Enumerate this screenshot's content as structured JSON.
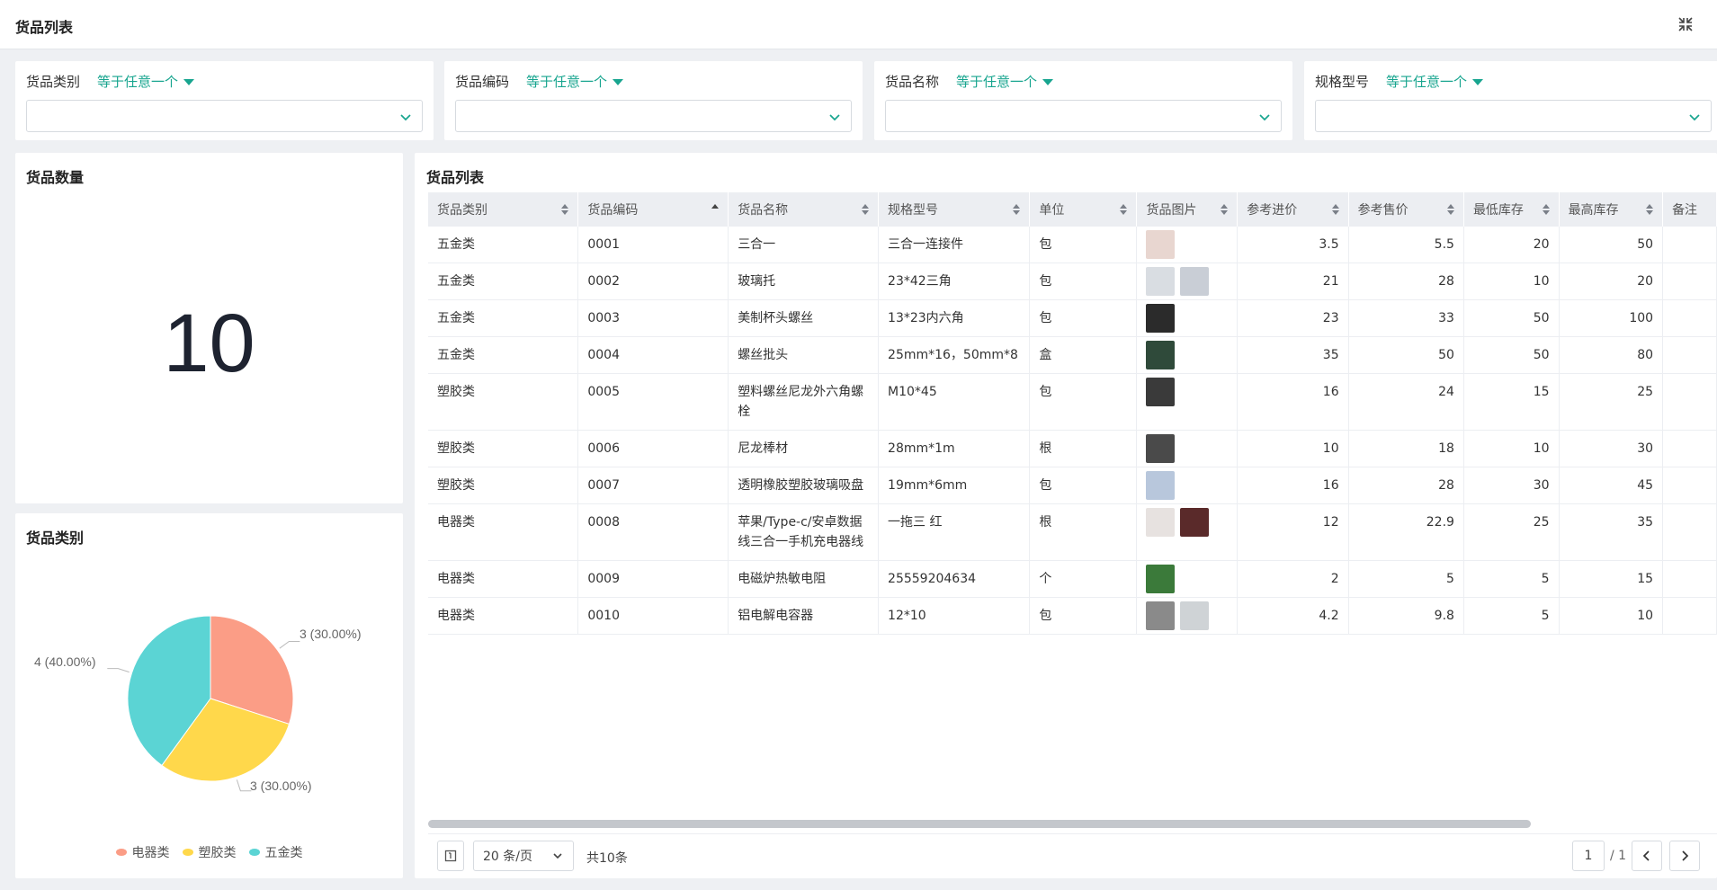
{
  "header": {
    "title": "货品列表",
    "collapse_icon": "collapse-icon"
  },
  "filters": [
    {
      "label": "货品类别",
      "operator": "等于任意一个",
      "value": ""
    },
    {
      "label": "货品编码",
      "operator": "等于任意一个",
      "value": ""
    },
    {
      "label": "货品名称",
      "operator": "等于任意一个",
      "value": ""
    },
    {
      "label": "规格型号",
      "operator": "等于任意一个",
      "value": ""
    }
  ],
  "count_card": {
    "title": "货品数量",
    "value": "10"
  },
  "category_card": {
    "title": "货品类别",
    "labels": [
      "3 (30.00%)",
      "4 (40.00%)",
      "3 (30.00%)"
    ]
  },
  "chart_data": {
    "type": "pie",
    "categories": [
      "电器类",
      "塑胶类",
      "五金类"
    ],
    "values": [
      3,
      3,
      4
    ],
    "percentages": [
      "30.00%",
      "30.00%",
      "40.00%"
    ],
    "colors": [
      "#fb9d86",
      "#ffd84b",
      "#5bd4d4"
    ],
    "legend_position": "bottom"
  },
  "table": {
    "title": "货品列表",
    "columns": [
      "货品类别",
      "货品编码",
      "货品名称",
      "规格型号",
      "单位",
      "货品图片",
      "参考进价",
      "参考售价",
      "最低库存",
      "最高库存",
      "备注"
    ],
    "rows": [
      [
        "五金类",
        "0001",
        "三合一",
        "三合一连接件",
        "包",
        "",
        "3.5",
        "5.5",
        "20",
        "50",
        ""
      ],
      [
        "五金类",
        "0002",
        "玻璃托",
        "23*42三角",
        "包",
        "",
        "21",
        "28",
        "10",
        "20",
        ""
      ],
      [
        "五金类",
        "0003",
        "美制杯头螺丝",
        "13*23内六角",
        "包",
        "",
        "23",
        "33",
        "50",
        "100",
        ""
      ],
      [
        "五金类",
        "0004",
        "螺丝批头",
        "25mm*16，50mm*8",
        "盒",
        "",
        "35",
        "50",
        "50",
        "80",
        ""
      ],
      [
        "塑胶类",
        "0005",
        "塑料螺丝尼龙外六角螺栓",
        "M10*45",
        "包",
        "",
        "16",
        "24",
        "15",
        "25",
        ""
      ],
      [
        "塑胶类",
        "0006",
        "尼龙棒材",
        "28mm*1m",
        "根",
        "",
        "10",
        "18",
        "10",
        "30",
        ""
      ],
      [
        "塑胶类",
        "0007",
        "透明橡胶塑胶玻璃吸盘",
        "19mm*6mm",
        "包",
        "",
        "16",
        "28",
        "30",
        "45",
        ""
      ],
      [
        "电器类",
        "0008",
        "苹果/Type-c/安卓数据线三合一手机充电器线",
        "一拖三 红",
        "根",
        "",
        "12",
        "22.9",
        "25",
        "35",
        ""
      ],
      [
        "电器类",
        "0009",
        "电磁炉热敏电阻",
        "25559204634",
        "个",
        "",
        "2",
        "5",
        "5",
        "15",
        ""
      ],
      [
        "电器类",
        "0010",
        "铝电解电容器",
        "12*10",
        "包",
        "",
        "4.2",
        "9.8",
        "5",
        "10",
        ""
      ]
    ],
    "thumb_colors": [
      [
        "#e8d6d0"
      ],
      [
        "#d9dde2",
        "#c9ced6"
      ],
      [
        "#2b2b2b"
      ],
      [
        "#2f4a3a"
      ],
      [
        "#3a3a3a"
      ],
      [
        "#4a4a4a"
      ],
      [
        "#b8c7dc"
      ],
      [
        "#e7e2e0",
        "#5a2a2a"
      ],
      [
        "#3b7a3a"
      ],
      [
        "#8a8a8a",
        "#cfd3d6"
      ]
    ]
  },
  "pagination": {
    "page_size": "20 条/页",
    "total": "共10条",
    "current": "1",
    "pages": "/ 1"
  }
}
